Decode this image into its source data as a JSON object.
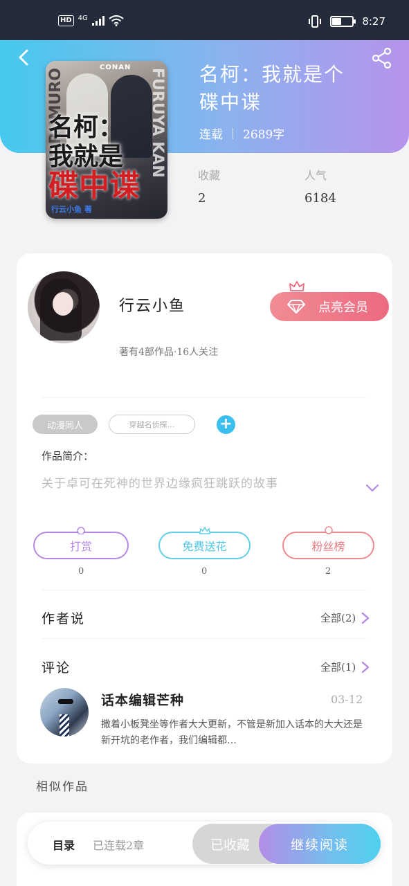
{
  "status_bar": {
    "hd": "HD",
    "network": "4G",
    "time": "8:27",
    "battery_level": 0.45
  },
  "book": {
    "title": "名柯：我就是个碟中谍",
    "status": "连载",
    "word_count": "2689字",
    "cover": {
      "series_mark": "CONAN",
      "title_line1": "名柯：",
      "title_line2": "我就是",
      "title_line3": "碟中谍",
      "side_left": "ORUMURO",
      "side_right": "FURUYA KAN",
      "author": "行云小鱼 著"
    },
    "stats": [
      {
        "label": "收藏",
        "value": "2"
      },
      {
        "label": "人气",
        "value": "6184"
      }
    ]
  },
  "author": {
    "name": "行云小鱼",
    "stats": "著有4部作品·16人关注"
  },
  "vip": {
    "label": "点亮会员"
  },
  "tags": {
    "primary": "动漫同人",
    "secondary": "穿越名侦探…"
  },
  "intro": {
    "label": "作品简介：",
    "text": "关于卓可在死神的世界边缘疯狂跳跃的故事"
  },
  "actions": [
    {
      "label": "打赏",
      "count": "0"
    },
    {
      "label": "免费送花",
      "count": "0"
    },
    {
      "label": "粉丝榜",
      "count": "2"
    }
  ],
  "author_notes": {
    "title": "作者说",
    "more": "全部(2)"
  },
  "comments": {
    "title": "评论",
    "more": "全部(1)",
    "items": [
      {
        "name": "话本编辑芒种",
        "date": "03-12",
        "text": "撒着小板凳坐等作者大大更新，不管是新加入话本的大大还是新开坑的老作者，我们编辑都…"
      }
    ]
  },
  "similar": {
    "title": "相似作品"
  },
  "bottom_bar": {
    "toc": "目录",
    "progress": "已连载2章",
    "collect": "已收藏",
    "read": "继续阅读"
  },
  "colors": {
    "header_start": "#46c9ee",
    "header_end": "#b693ec",
    "vip": "#ec6a80",
    "accent_blue": "#3bbfee"
  }
}
